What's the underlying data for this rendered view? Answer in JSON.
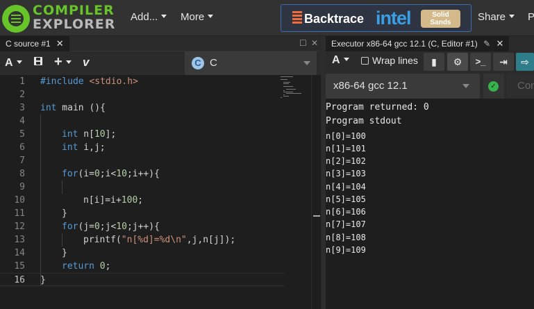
{
  "nav": {
    "logo_line1": "COMPILER",
    "logo_line2": "EXPLORER",
    "add_label": "Add...",
    "more_label": "More",
    "share_label": "Share",
    "policies_label": "P",
    "sponsor_backtrace": "Backtrace",
    "sponsor_intel": "intel",
    "sponsor_solid": "Solid",
    "sponsor_sands": "Sands"
  },
  "editor": {
    "tab_title": "C source #1",
    "language": "C",
    "lines": [
      {
        "n": "1"
      },
      {
        "n": "2"
      },
      {
        "n": "3"
      },
      {
        "n": "4"
      },
      {
        "n": "5"
      },
      {
        "n": "6"
      },
      {
        "n": "7"
      },
      {
        "n": "8"
      },
      {
        "n": "9"
      },
      {
        "n": "10"
      },
      {
        "n": "11"
      },
      {
        "n": "12"
      },
      {
        "n": "13"
      },
      {
        "n": "14"
      },
      {
        "n": "15"
      },
      {
        "n": "16"
      }
    ],
    "code": {
      "l1_directive": "#include",
      "l1_header": "<stdio.h>",
      "l3_type": "int",
      "l3_rest": " main (){",
      "l5_type": "int",
      "l5_rest": " n[",
      "l5_num": "10",
      "l5_end": "];",
      "l6_type": "int",
      "l6_rest": " i,j;",
      "l8_kw": "for",
      "l8_a": "(i=",
      "l8_n1": "0",
      "l8_b": ";i<",
      "l8_n2": "10",
      "l8_c": ";i++){",
      "l10_a": "n[i]=i+",
      "l10_num": "100",
      "l10_end": ";",
      "l11": "}",
      "l12_kw": "for",
      "l12_a": "(j=",
      "l12_n1": "0",
      "l12_b": ";j<",
      "l12_n2": "10",
      "l12_c": ";j++){",
      "l13_fn": "printf(",
      "l13_str": "\"n[%d]=%d\\n\"",
      "l13_rest": ",j,n[j]);",
      "l14": "}",
      "l15_kw": "return",
      "l15_num": "0",
      "l15_end": ";",
      "l16": "}"
    }
  },
  "executor": {
    "tab_title": "Executor x86-64 gcc 12.1 (C, Editor #1)",
    "wrap_lines_label": "Wrap lines",
    "compiler": "x86-64 gcc 12.1",
    "options_placeholder": "Con",
    "returned": "Program returned: 0",
    "stdout_label": "Program stdout",
    "stdout": [
      "n[0]=100",
      "n[1]=101",
      "n[2]=102",
      "n[3]=103",
      "n[4]=104",
      "n[5]=105",
      "n[6]=106",
      "n[7]=107",
      "n[8]=108",
      "n[9]=109"
    ]
  },
  "colors": {
    "brand_green": "#67c52a",
    "keyword_blue": "#569cd6",
    "number_green": "#b5cea8",
    "string_orange": "#ce9178",
    "success_green": "#38b24a"
  }
}
